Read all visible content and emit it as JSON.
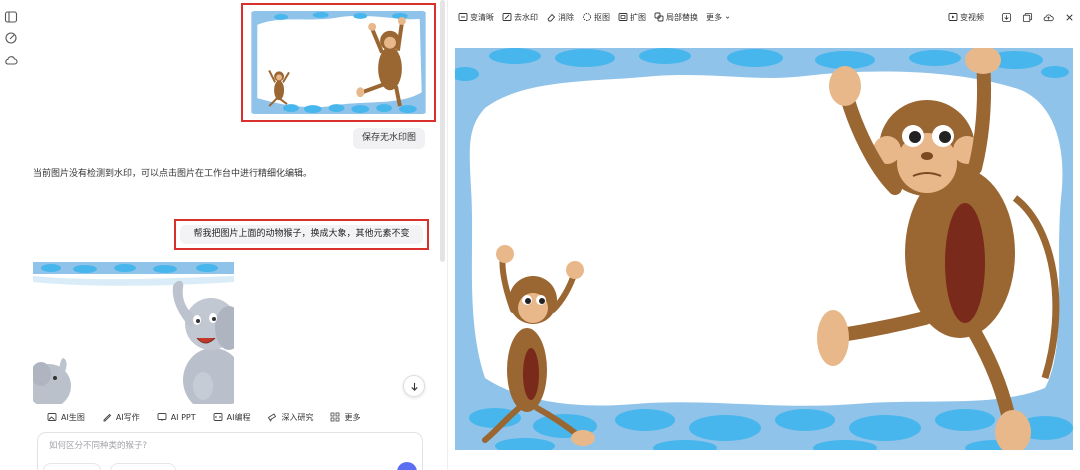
{
  "rail": {
    "icons": [
      "sidebar-toggle-icon",
      "new-chat-icon",
      "cloud-icon"
    ]
  },
  "chat": {
    "save_watermark_free_label": "保存无水印图",
    "info_message": "当前图片没有检测到水印，可以点击图片在工作台中进行精细化编辑。",
    "user_message": "帮我把图片上面的动物猴子，换成大象，其他元素不变",
    "tools": [
      {
        "label": "AI生图",
        "icon": "image-gen-icon"
      },
      {
        "label": "AI写作",
        "icon": "pen-icon"
      },
      {
        "label": "AI PPT",
        "icon": "ppt-icon"
      },
      {
        "label": "AI编程",
        "icon": "code-icon"
      },
      {
        "label": "深入研究",
        "icon": "telescope-icon"
      },
      {
        "label": "更多",
        "icon": "grid-icon"
      }
    ],
    "input_placeholder": "如何区分不同种类的猴子?"
  },
  "toolbar": {
    "items": [
      {
        "label": "变清晰",
        "icon": "enhance-icon"
      },
      {
        "label": "去水印",
        "icon": "remove-watermark-icon"
      },
      {
        "label": "消除",
        "icon": "eraser-icon"
      },
      {
        "label": "抠图",
        "icon": "cutout-icon"
      },
      {
        "label": "扩图",
        "icon": "expand-icon"
      },
      {
        "label": "局部替换",
        "icon": "partial-replace-icon"
      },
      {
        "label": "更多",
        "icon": "chevron-down-icon"
      }
    ],
    "video_label": "变视频"
  },
  "colors": {
    "accent_red": "#d9302b",
    "send": "#5b6ef2",
    "frame_blue": "#8fc3ea",
    "spot_blue": "#47b6ec",
    "monkey_brown": "#9a6631"
  }
}
